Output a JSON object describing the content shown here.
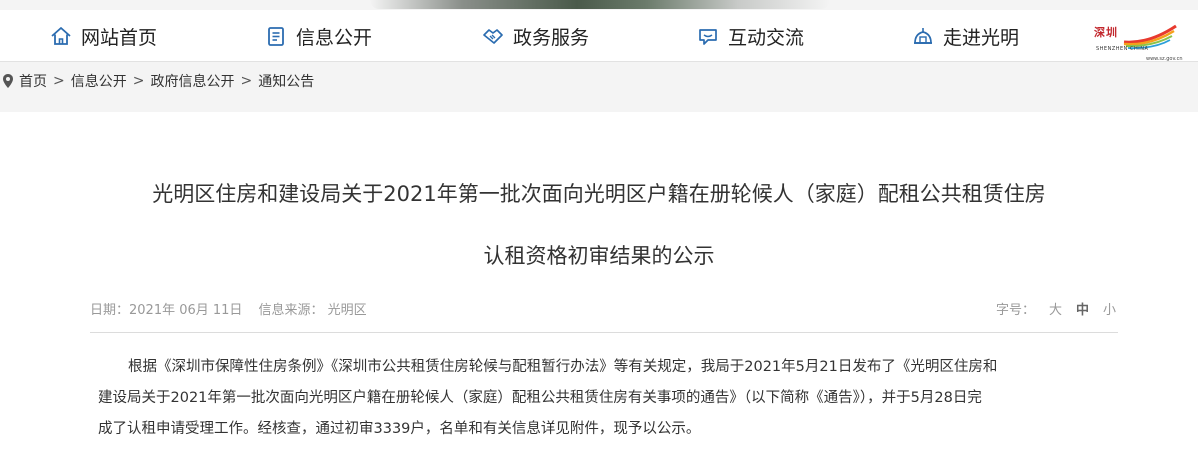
{
  "nav": {
    "items": [
      {
        "label": "网站首页",
        "icon": "home-icon"
      },
      {
        "label": "信息公开",
        "icon": "document-icon"
      },
      {
        "label": "政务服务",
        "icon": "handshake-icon"
      },
      {
        "label": "互动交流",
        "icon": "chat-icon"
      },
      {
        "label": "走进光明",
        "icon": "building-icon"
      }
    ],
    "logo": {
      "brand_text": "深圳",
      "tagline": "SHENZHEN CHINA",
      "url": "www.sz.gov.cn"
    }
  },
  "breadcrumb": {
    "icon": "location-pin-icon",
    "items": [
      "首页",
      "信息公开",
      "政府信息公开",
      "通知公告"
    ],
    "separator": ">"
  },
  "article": {
    "title_line1": "光明区住房和建设局关于2021年第一批次面向光明区户籍在册轮候人（家庭）配租公共租赁住房",
    "title_line2": "认租资格初审结果的公示",
    "date": "日期：2021年 06月 11日",
    "source": "信息来源： 光明区",
    "font_size_label": "字号：",
    "font_sizes": [
      "大",
      "中",
      "小"
    ],
    "body_lines": [
      "根据《深圳市保障性住房条例》《深圳市公共租赁住房轮候与配租暂行办法》等有关规定，我局于2021年5月21日发布了《光明区住房和",
      "建设局关于2021年第一批次面向光明区户籍在册轮候人（家庭）配租公共租赁住房有关事项的通告》（以下简称《通告》），并于5月28日完",
      "成了认租申请受理工作。经核查，通过初审3339户，名单和有关信息详见附件，现予以公示。"
    ]
  },
  "colors": {
    "nav_icon": "#2b6cb0",
    "text": "#333333",
    "meta_text": "#999999",
    "page_bg": "#f4f4f4"
  }
}
